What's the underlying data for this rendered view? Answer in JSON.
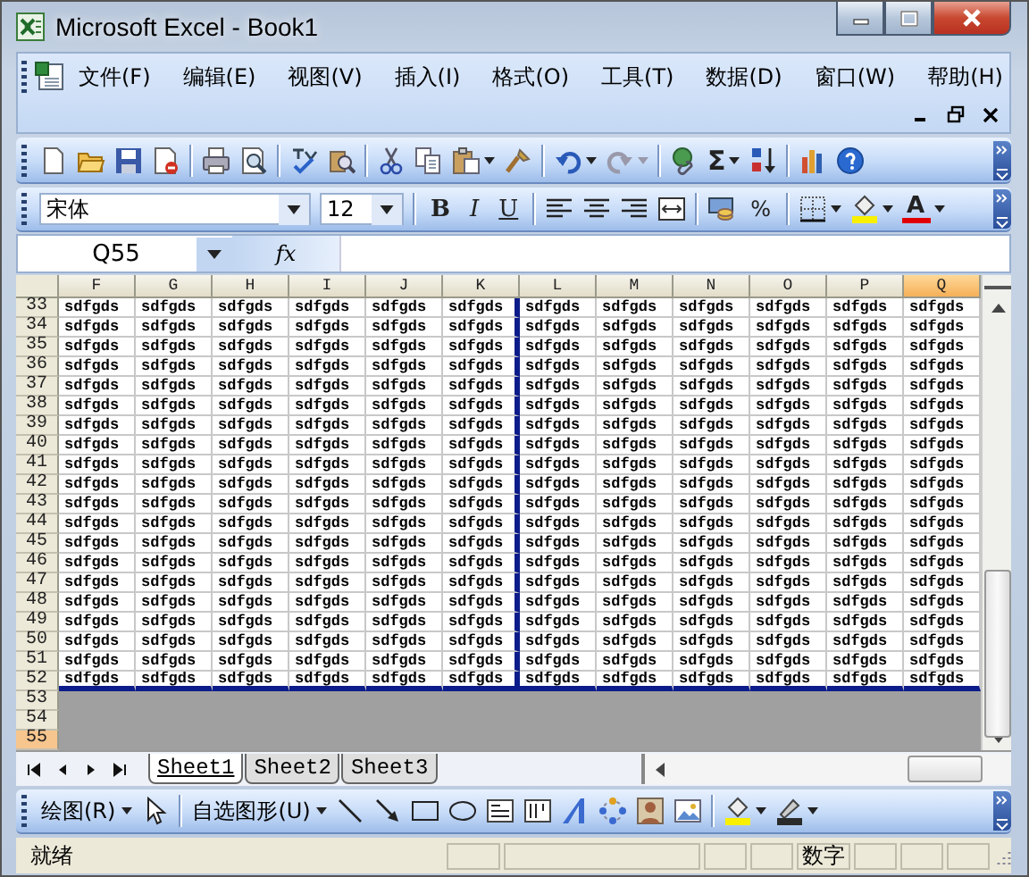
{
  "window": {
    "title": "Microsoft Excel - Book1"
  },
  "menu": [
    "文件(F)",
    "编辑(E)",
    "视图(V)",
    "插入(I)",
    "格式(O)",
    "工具(T)",
    "数据(D)",
    "窗口(W)",
    "帮助(H)"
  ],
  "standard_toolbar": {
    "autosum": "Σ"
  },
  "formatting_toolbar": {
    "font": "宋体",
    "size": "12",
    "bold": "B",
    "italic": "I",
    "underline": "U",
    "percent": "%",
    "font_color": "A"
  },
  "formula_bar": {
    "name_box": "Q55",
    "fx": "fx"
  },
  "columns": [
    {
      "label": "F",
      "selected": false,
      "page_break_after": false
    },
    {
      "label": "G",
      "selected": false,
      "page_break_after": false
    },
    {
      "label": "H",
      "selected": false,
      "page_break_after": false
    },
    {
      "label": "I",
      "selected": false,
      "page_break_after": false
    },
    {
      "label": "J",
      "selected": false,
      "page_break_after": false
    },
    {
      "label": "K",
      "selected": false,
      "page_break_after": true
    },
    {
      "label": "L",
      "selected": false,
      "page_break_after": false
    },
    {
      "label": "M",
      "selected": false,
      "page_break_after": false
    },
    {
      "label": "N",
      "selected": false,
      "page_break_after": false
    },
    {
      "label": "O",
      "selected": false,
      "page_break_after": false
    },
    {
      "label": "P",
      "selected": false,
      "page_break_after": false
    },
    {
      "label": "Q",
      "selected": true,
      "page_break_after": false
    }
  ],
  "rows": [
    {
      "header": "33",
      "selected": false,
      "cells": [
        "sdfgds",
        "sdfgds",
        "sdfgds",
        "sdfgds",
        "sdfgds",
        "sdfgds",
        "sdfgds",
        "sdfgds",
        "sdfgds",
        "sdfgds",
        "sdfgds",
        "sdfgds"
      ]
    },
    {
      "header": "34",
      "selected": false,
      "cells": [
        "sdfgds",
        "sdfgds",
        "sdfgds",
        "sdfgds",
        "sdfgds",
        "sdfgds",
        "sdfgds",
        "sdfgds",
        "sdfgds",
        "sdfgds",
        "sdfgds",
        "sdfgds"
      ]
    },
    {
      "header": "35",
      "selected": false,
      "cells": [
        "sdfgds",
        "sdfgds",
        "sdfgds",
        "sdfgds",
        "sdfgds",
        "sdfgds",
        "sdfgds",
        "sdfgds",
        "sdfgds",
        "sdfgds",
        "sdfgds",
        "sdfgds"
      ]
    },
    {
      "header": "36",
      "selected": false,
      "cells": [
        "sdfgds",
        "sdfgds",
        "sdfgds",
        "sdfgds",
        "sdfgds",
        "sdfgds",
        "sdfgds",
        "sdfgds",
        "sdfgds",
        "sdfgds",
        "sdfgds",
        "sdfgds"
      ]
    },
    {
      "header": "37",
      "selected": false,
      "cells": [
        "sdfgds",
        "sdfgds",
        "sdfgds",
        "sdfgds",
        "sdfgds",
        "sdfgds",
        "sdfgds",
        "sdfgds",
        "sdfgds",
        "sdfgds",
        "sdfgds",
        "sdfgds"
      ]
    },
    {
      "header": "38",
      "selected": false,
      "cells": [
        "sdfgds",
        "sdfgds",
        "sdfgds",
        "sdfgds",
        "sdfgds",
        "sdfgds",
        "sdfgds",
        "sdfgds",
        "sdfgds",
        "sdfgds",
        "sdfgds",
        "sdfgds"
      ]
    },
    {
      "header": "39",
      "selected": false,
      "cells": [
        "sdfgds",
        "sdfgds",
        "sdfgds",
        "sdfgds",
        "sdfgds",
        "sdfgds",
        "sdfgds",
        "sdfgds",
        "sdfgds",
        "sdfgds",
        "sdfgds",
        "sdfgds"
      ]
    },
    {
      "header": "40",
      "selected": false,
      "cells": [
        "sdfgds",
        "sdfgds",
        "sdfgds",
        "sdfgds",
        "sdfgds",
        "sdfgds",
        "sdfgds",
        "sdfgds",
        "sdfgds",
        "sdfgds",
        "sdfgds",
        "sdfgds"
      ]
    },
    {
      "header": "41",
      "selected": false,
      "cells": [
        "sdfgds",
        "sdfgds",
        "sdfgds",
        "sdfgds",
        "sdfgds",
        "sdfgds",
        "sdfgds",
        "sdfgds",
        "sdfgds",
        "sdfgds",
        "sdfgds",
        "sdfgds"
      ]
    },
    {
      "header": "42",
      "selected": false,
      "cells": [
        "sdfgds",
        "sdfgds",
        "sdfgds",
        "sdfgds",
        "sdfgds",
        "sdfgds",
        "sdfgds",
        "sdfgds",
        "sdfgds",
        "sdfgds",
        "sdfgds",
        "sdfgds"
      ]
    },
    {
      "header": "43",
      "selected": false,
      "cells": [
        "sdfgds",
        "sdfgds",
        "sdfgds",
        "sdfgds",
        "sdfgds",
        "sdfgds",
        "sdfgds",
        "sdfgds",
        "sdfgds",
        "sdfgds",
        "sdfgds",
        "sdfgds"
      ]
    },
    {
      "header": "44",
      "selected": false,
      "cells": [
        "sdfgds",
        "sdfgds",
        "sdfgds",
        "sdfgds",
        "sdfgds",
        "sdfgds",
        "sdfgds",
        "sdfgds",
        "sdfgds",
        "sdfgds",
        "sdfgds",
        "sdfgds"
      ]
    },
    {
      "header": "45",
      "selected": false,
      "cells": [
        "sdfgds",
        "sdfgds",
        "sdfgds",
        "sdfgds",
        "sdfgds",
        "sdfgds",
        "sdfgds",
        "sdfgds",
        "sdfgds",
        "sdfgds",
        "sdfgds",
        "sdfgds"
      ]
    },
    {
      "header": "46",
      "selected": false,
      "cells": [
        "sdfgds",
        "sdfgds",
        "sdfgds",
        "sdfgds",
        "sdfgds",
        "sdfgds",
        "sdfgds",
        "sdfgds",
        "sdfgds",
        "sdfgds",
        "sdfgds",
        "sdfgds"
      ]
    },
    {
      "header": "47",
      "selected": false,
      "cells": [
        "sdfgds",
        "sdfgds",
        "sdfgds",
        "sdfgds",
        "sdfgds",
        "sdfgds",
        "sdfgds",
        "sdfgds",
        "sdfgds",
        "sdfgds",
        "sdfgds",
        "sdfgds"
      ]
    },
    {
      "header": "48",
      "selected": false,
      "cells": [
        "sdfgds",
        "sdfgds",
        "sdfgds",
        "sdfgds",
        "sdfgds",
        "sdfgds",
        "sdfgds",
        "sdfgds",
        "sdfgds",
        "sdfgds",
        "sdfgds",
        "sdfgds"
      ]
    },
    {
      "header": "49",
      "selected": false,
      "cells": [
        "sdfgds",
        "sdfgds",
        "sdfgds",
        "sdfgds",
        "sdfgds",
        "sdfgds",
        "sdfgds",
        "sdfgds",
        "sdfgds",
        "sdfgds",
        "sdfgds",
        "sdfgds"
      ]
    },
    {
      "header": "50",
      "selected": false,
      "cells": [
        "sdfgds",
        "sdfgds",
        "sdfgds",
        "sdfgds",
        "sdfgds",
        "sdfgds",
        "sdfgds",
        "sdfgds",
        "sdfgds",
        "sdfgds",
        "sdfgds",
        "sdfgds"
      ]
    },
    {
      "header": "51",
      "selected": false,
      "cells": [
        "sdfgds",
        "sdfgds",
        "sdfgds",
        "sdfgds",
        "sdfgds",
        "sdfgds",
        "sdfgds",
        "sdfgds",
        "sdfgds",
        "sdfgds",
        "sdfgds",
        "sdfgds"
      ]
    },
    {
      "header": "52",
      "selected": false,
      "cells": [
        "sdfgds",
        "sdfgds",
        "sdfgds",
        "sdfgds",
        "sdfgds",
        "sdfgds",
        "sdfgds",
        "sdfgds",
        "sdfgds",
        "sdfgds",
        "sdfgds",
        "sdfgds"
      ]
    },
    {
      "header": "53",
      "selected": false
    },
    {
      "header": "54",
      "selected": false
    },
    {
      "header": "55",
      "selected": true
    }
  ],
  "sheet_tabs": [
    {
      "label": "Sheet1",
      "selected": true
    },
    {
      "label": "Sheet2",
      "selected": false
    },
    {
      "label": "Sheet3",
      "selected": false
    }
  ],
  "drawing_toolbar": {
    "draw_menu": "绘图(R)",
    "autoshapes_menu": "自选图形(U)"
  },
  "status_bar": {
    "status": "就绪",
    "num_mode": "数字"
  }
}
